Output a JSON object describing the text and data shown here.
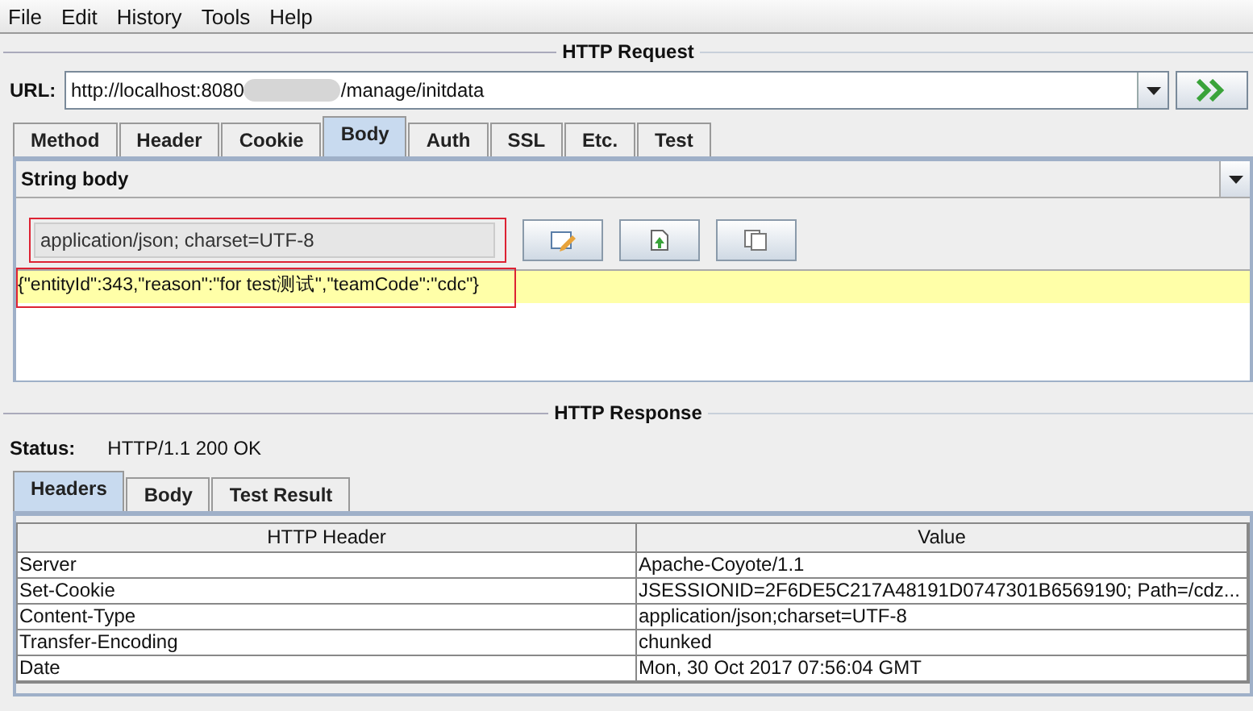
{
  "menu": [
    {
      "label": "File"
    },
    {
      "label": "Edit"
    },
    {
      "label": "History"
    },
    {
      "label": "Tools"
    },
    {
      "label": "Help"
    }
  ],
  "request": {
    "title": "HTTP Request",
    "url_label": "URL:",
    "url_start": "http://localhost:8080",
    "url_redacted": true,
    "url_end": "/manage/initdata",
    "tabs": [
      {
        "label": "Method",
        "selected": false
      },
      {
        "label": "Header",
        "selected": false
      },
      {
        "label": "Cookie",
        "selected": false
      },
      {
        "label": "Body",
        "selected": true
      },
      {
        "label": "Auth",
        "selected": false
      },
      {
        "label": "SSL",
        "selected": false
      },
      {
        "label": "Etc.",
        "selected": false
      },
      {
        "label": "Test",
        "selected": false
      }
    ],
    "body_type": "String body",
    "content_type": "application/json; charset=UTF-8",
    "content_type_highlighted": true,
    "body_text": "{\"entityId\":343,\"reason\":\"for test测试\",\"teamCode\":\"cdc\"}",
    "body_highlighted": true
  },
  "response": {
    "title": "HTTP Response",
    "status_label": "Status:",
    "status": "HTTP/1.1 200 OK",
    "tabs": [
      {
        "label": "Headers",
        "selected": true
      },
      {
        "label": "Body",
        "selected": false
      },
      {
        "label": "Test Result",
        "selected": false
      }
    ],
    "table": {
      "columns": [
        "HTTP Header",
        "Value"
      ],
      "rows": [
        [
          "Server",
          "Apache-Coyote/1.1"
        ],
        [
          "Set-Cookie",
          "JSESSIONID=2F6DE5C217A48191D0747301B6569190; Path=/cdz..."
        ],
        [
          "Content-Type",
          "application/json;charset=UTF-8"
        ],
        [
          "Transfer-Encoding",
          "chunked"
        ],
        [
          "Date",
          "Mon, 30 Oct 2017 07:56:04 GMT"
        ]
      ]
    }
  }
}
